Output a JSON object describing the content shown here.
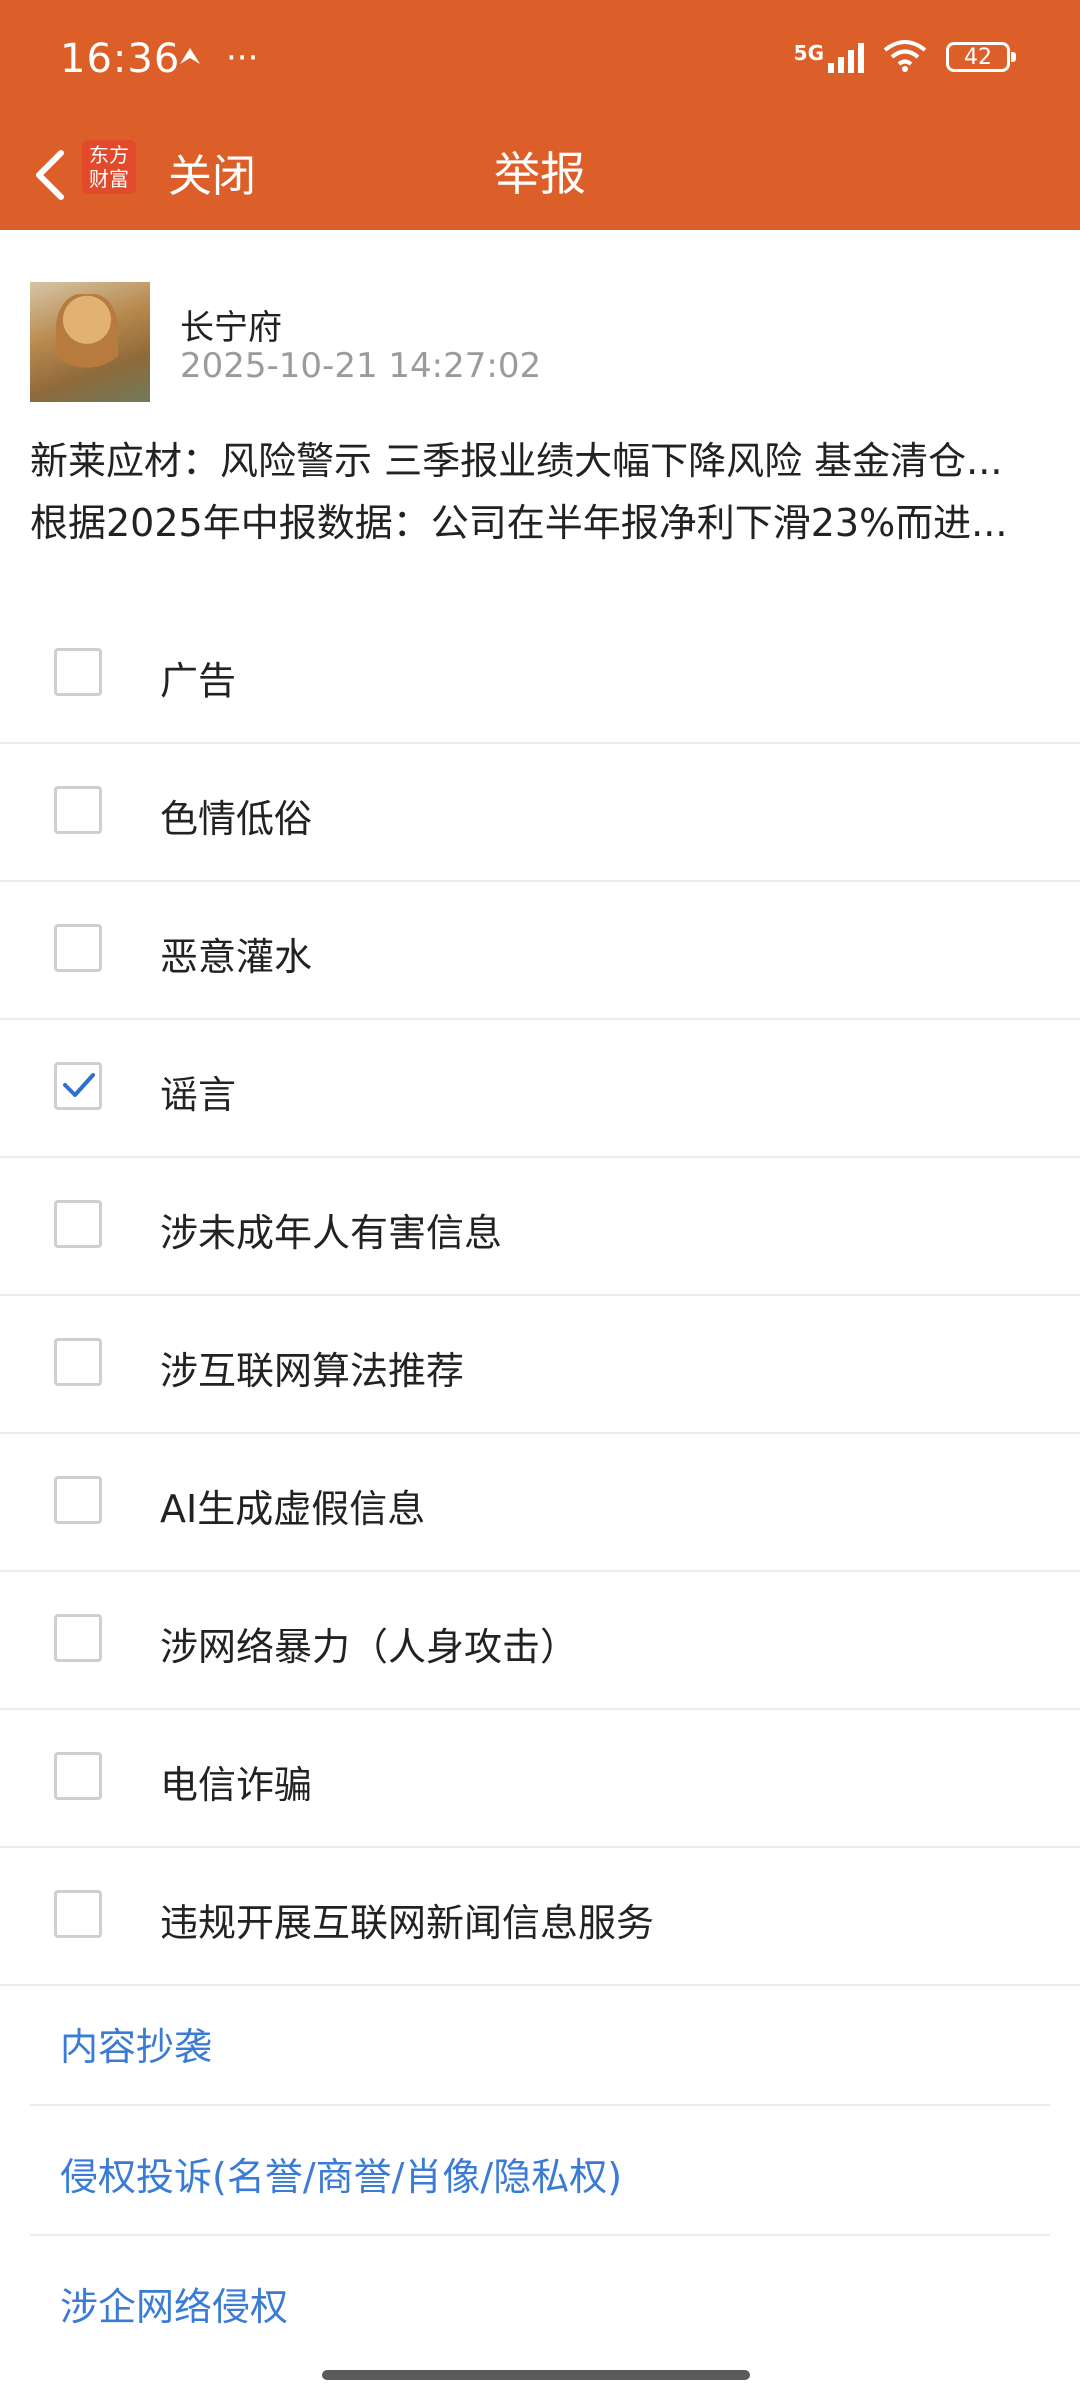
{
  "colors": {
    "accent": "#dc5f2a",
    "link": "#3a7bd5",
    "check": "#2f6fcf"
  },
  "status": {
    "time": "16:36",
    "network": "5G",
    "battery": "42"
  },
  "navbar": {
    "logo_text_line1": "东方",
    "logo_text_line2": "财富",
    "close_label": "关闭",
    "title": "举报"
  },
  "post": {
    "username": "长宁府",
    "timestamp": "2025-10-21 14:27:02",
    "title_line": "新莱应材：风险警示 三季报业绩大幅下降风险 基金清仓...",
    "body_line": "根据2025年中报数据：公司在半年报净利下滑23%而进..."
  },
  "reasons": [
    {
      "label": "广告",
      "checked": false
    },
    {
      "label": "色情低俗",
      "checked": false
    },
    {
      "label": "恶意灌水",
      "checked": false
    },
    {
      "label": "谣言",
      "checked": true
    },
    {
      "label": "涉未成年人有害信息",
      "checked": false
    },
    {
      "label": "涉互联网算法推荐",
      "checked": false
    },
    {
      "label": "AI生成虚假信息",
      "checked": false
    },
    {
      "label": "涉网络暴力（人身攻击）",
      "checked": false
    },
    {
      "label": "电信诈骗",
      "checked": false
    },
    {
      "label": "违规开展互联网新闻信息服务",
      "checked": false
    }
  ],
  "links": [
    {
      "label": "内容抄袭"
    },
    {
      "label": "侵权投诉(名誉/商誉/肖像/隐私权)"
    },
    {
      "label": "涉企网络侵权"
    }
  ]
}
